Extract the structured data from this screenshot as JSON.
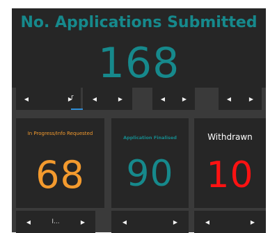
{
  "header_panel": {
    "title": "No. Applications Submitted",
    "value": "168",
    "color": "#16898c"
  },
  "nav_labels": {
    "submitted_left_text": "r",
    "in_progress_text": "I..."
  },
  "cards": [
    {
      "label": "In Progress/Info Requested",
      "value": "68",
      "color": "#f39a2e"
    },
    {
      "label": "Application Finalised",
      "value": "90",
      "color": "#16898c"
    },
    {
      "label": "Withdrawn",
      "value": "10",
      "color": "#ff1212"
    }
  ],
  "icons": {
    "left": "caret-left-icon",
    "right": "caret-right-icon"
  },
  "colors": {
    "panel_bg": "#262626",
    "gap_bg": "#3a3a3a",
    "tab_underline": "#2f8fd8"
  }
}
